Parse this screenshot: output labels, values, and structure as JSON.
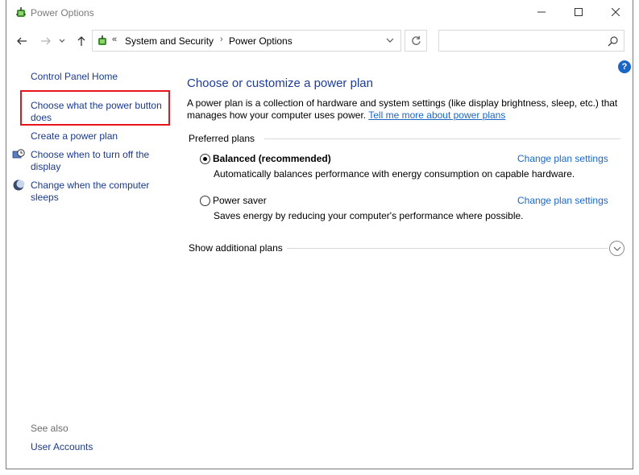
{
  "window": {
    "title": "Power Options"
  },
  "address": {
    "chevron": "«",
    "crumbs": [
      "System and Security",
      "Power Options"
    ],
    "separator": "›",
    "search_placeholder": ""
  },
  "help_label": "?",
  "sidebar": {
    "home": "Control Panel Home",
    "items": [
      {
        "label": "Choose what the power button does",
        "icon": ""
      },
      {
        "label": "Create a power plan",
        "icon": ""
      },
      {
        "label": "Choose when to turn off the display",
        "icon": "display-clock-icon"
      },
      {
        "label": "Change when the computer sleeps",
        "icon": "moon-icon"
      }
    ],
    "see_also": "See also",
    "see_also_links": [
      "User Accounts"
    ]
  },
  "main": {
    "title": "Choose or customize a power plan",
    "description": "A power plan is a collection of hardware and system settings (like display brightness, sleep, etc.) that manages how your computer uses power.",
    "tell_more": "Tell me more about power plans",
    "preferred_label": "Preferred plans",
    "plans": [
      {
        "name": "Balanced (recommended)",
        "description": "Automatically balances performance with energy consumption on capable hardware.",
        "selected": true,
        "change_label": "Change plan settings"
      },
      {
        "name": "Power saver",
        "description": "Saves energy by reducing your computer's performance where possible.",
        "selected": false,
        "change_label": "Change plan settings"
      }
    ],
    "show_additional": "Show additional plans"
  },
  "colors": {
    "link": "#1a66c7",
    "title": "#1e3c96",
    "highlight": "#e8141b"
  }
}
